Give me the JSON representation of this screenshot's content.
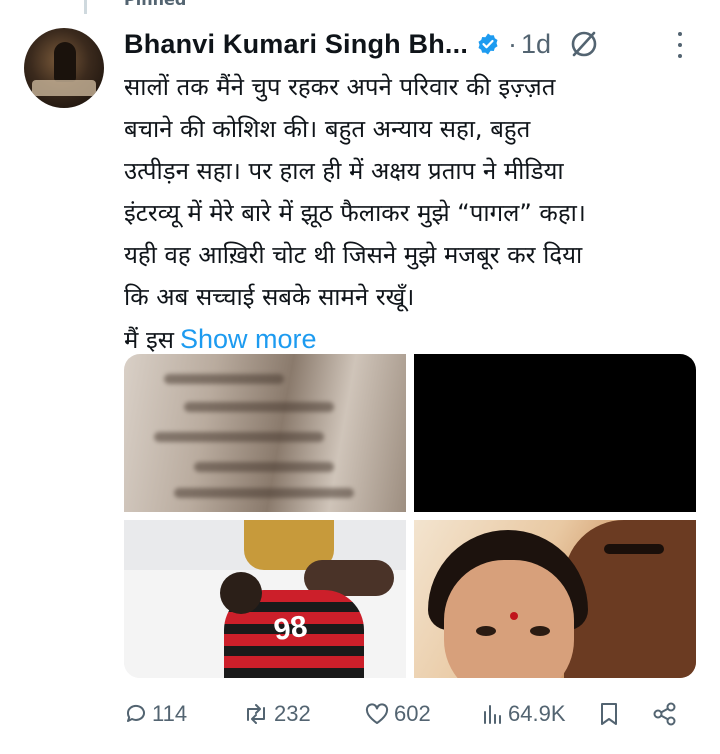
{
  "pinned": {
    "label": "Pinned"
  },
  "tweet": {
    "author": "Bhanvi Kumari Singh Bh...",
    "separator": "·",
    "time": "1d",
    "text_lines": [
      "सालों तक मैंने चुप रहकर अपने परिवार की इज़्ज़त",
      "बचाने की कोशिश की। बहुत अन्याय सहा, बहुत",
      "उत्पीड़न सहा। पर हाल ही में अक्षय प्रताप ने मीडिया",
      "इंटरव्यू में मेरे बारे में झूठ फैलाकर मुझे “पागल” कहा।",
      "यही वह आख़िरी चोट थी जिसने मुझे मजबूर कर दिया",
      "कि अब सच्चाई सबके सामने रखूँ।",
      "मैं इस"
    ],
    "show_more": "Show more"
  },
  "actions": {
    "replies": "114",
    "reposts": "232",
    "likes": "602",
    "views": "64.9K"
  },
  "colors": {
    "link": "#1d9bf0",
    "secondary": "#536471",
    "verified": "#1d9bf0",
    "text": "#0f1419"
  },
  "icons": {
    "verified": "verified-badge-icon",
    "grok": "grok-icon",
    "more": "more-icon",
    "reply": "reply-icon",
    "repost": "repost-icon",
    "like": "like-icon",
    "views": "views-icon",
    "bookmark": "bookmark-icon",
    "share": "share-icon"
  }
}
